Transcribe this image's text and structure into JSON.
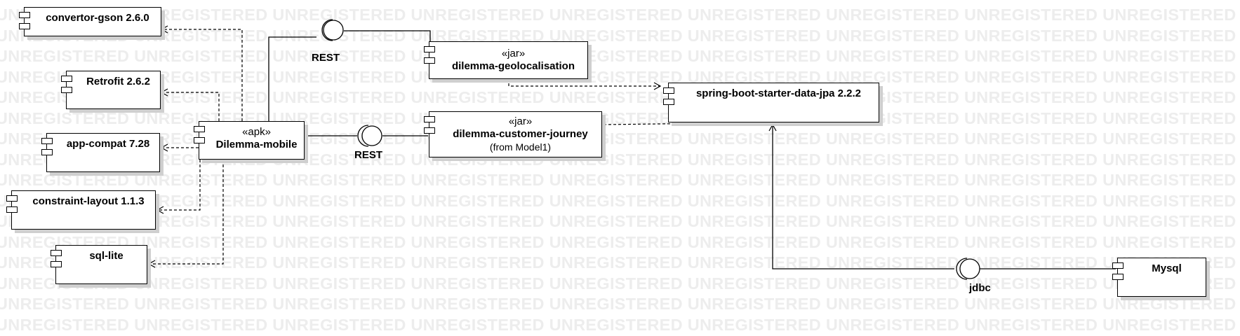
{
  "watermark": "UNREGISTERED UNREGISTERED UNREGISTERED UNREGISTERED UNREGISTERED UNREGISTERED UNREGISTERED UNREGISTERED UNREGISTERED UNREGISTERED",
  "components": {
    "convertor_gson": {
      "name": "convertor-gson 2.6.0"
    },
    "retrofit": {
      "name": "Retrofit 2.6.2"
    },
    "app_compat": {
      "name": "app-compat 7.28"
    },
    "constraint_layout": {
      "name": "constraint-layout 1.1.3"
    },
    "sql_lite": {
      "name": "sql-lite"
    },
    "dilemma_mobile": {
      "stereotype": "«apk»",
      "name": "Dilemma-mobile"
    },
    "dilemma_geolocalisation": {
      "stereotype": "«jar»",
      "name": "dilemma-geolocalisation"
    },
    "dilemma_customer_journey": {
      "stereotype": "«jar»",
      "name": "dilemma-customer-journey",
      "from": "(from Model1)"
    },
    "spring_boot": {
      "name": "spring-boot-starter-data-jpa 2.2.2"
    },
    "mysql": {
      "name": "Mysql"
    }
  },
  "interfaces": {
    "rest_top": "REST",
    "rest_mid": "REST",
    "jdbc": "jdbc"
  }
}
